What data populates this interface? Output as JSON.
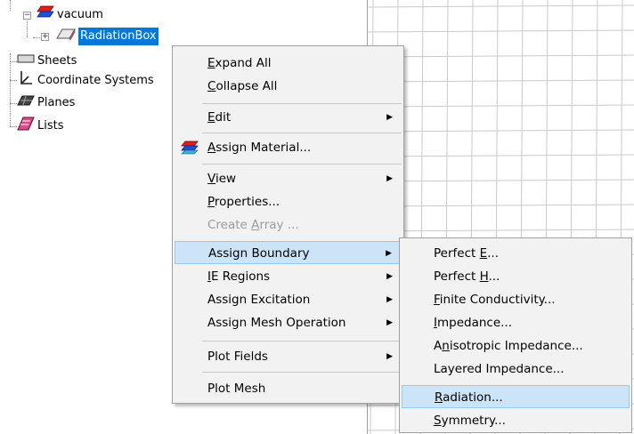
{
  "tree": {
    "vacuum": "vacuum",
    "radiation_box": "RadiationBox",
    "sheets": "Sheets",
    "coordinate_systems": "Coordinate Systems",
    "planes": "Planes",
    "lists": "Lists"
  },
  "context_menu": {
    "expand_all": {
      "pre": "",
      "acc": "E",
      "post": "xpand All"
    },
    "collapse_all": {
      "pre": "",
      "acc": "C",
      "post": "ollapse All"
    },
    "edit": {
      "pre": "",
      "acc": "E",
      "post": "dit"
    },
    "assign_material": {
      "pre": "",
      "acc": "A",
      "post": "ssign Material..."
    },
    "view": {
      "pre": "",
      "acc": "V",
      "post": "iew"
    },
    "properties": {
      "pre": "",
      "acc": "P",
      "post": "roperties..."
    },
    "create_array": {
      "pre": "Create ",
      "acc": "A",
      "post": "rray ..."
    },
    "assign_boundary": "Assign Boundary",
    "ie_regions": {
      "pre": "",
      "acc": "I",
      "post": "E Regions"
    },
    "assign_excitation": "Assign Excitation",
    "assign_mesh_operation": "Assign Mesh Operation",
    "plot_fields": "Plot Fields",
    "plot_mesh": "Plot Mesh"
  },
  "boundary_submenu": {
    "perfect_e": {
      "pre": "Perfect ",
      "acc": "E",
      "post": "..."
    },
    "perfect_h": {
      "pre": "Perfect ",
      "acc": "H",
      "post": "..."
    },
    "finite_conductivity": {
      "pre": "",
      "acc": "F",
      "post": "inite Conductivity..."
    },
    "impedance": {
      "pre": "",
      "acc": "I",
      "post": "mpedance..."
    },
    "anisotropic_impedance": {
      "pre": "A",
      "acc": "n",
      "post": "isotropic Impedance..."
    },
    "layered_impedance": "Layered Impedance...",
    "radiation": {
      "pre": "",
      "acc": "R",
      "post": "adiation..."
    },
    "symmetry": {
      "pre": "",
      "acc": "S",
      "post": "ymmetry..."
    }
  },
  "colors": {
    "menu_bg": "#f2f2f2",
    "highlight_bg": "#cce4f7",
    "highlight_border": "#99c9ef",
    "selection_bg": "#0078d7",
    "disabled_text": "#9a9a9a"
  },
  "icons": {
    "vacuum": "material-red-blue-icon",
    "radiation_box": "box-object-icon",
    "sheets": "sheet-icon",
    "coordinate_systems": "axes-icon",
    "planes": "plane-icon",
    "lists": "list-icon",
    "assign_material": "material-icon"
  }
}
